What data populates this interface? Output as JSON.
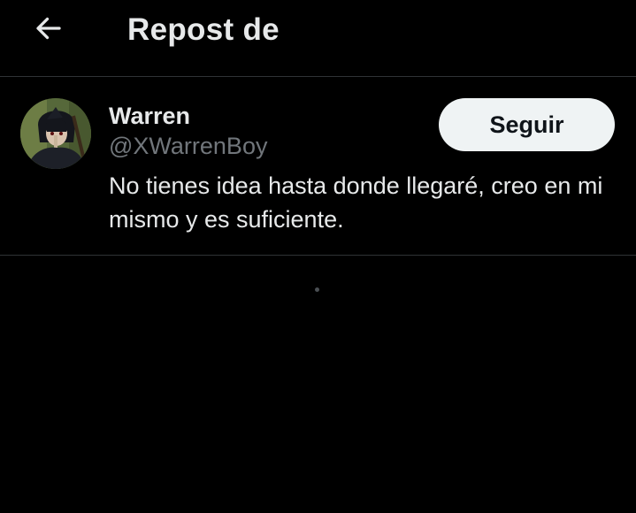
{
  "header": {
    "back_icon": "arrow-left-icon",
    "title": "Repost de"
  },
  "user": {
    "avatar_icon": "user-avatar",
    "display_name": "Warren",
    "handle": "@XWarrenBoy",
    "bio": "No tienes idea hasta donde llegaré, creo en mi mismo y es suficiente.",
    "follow_label": "Seguir"
  },
  "loading": {
    "icon": "loading-indicator-icon"
  },
  "colors": {
    "background": "#000000",
    "text_primary": "#e7e9ea",
    "text_secondary": "#71767b",
    "divider": "#2f3336",
    "button_bg": "#eff3f4",
    "button_text": "#0f1419"
  }
}
